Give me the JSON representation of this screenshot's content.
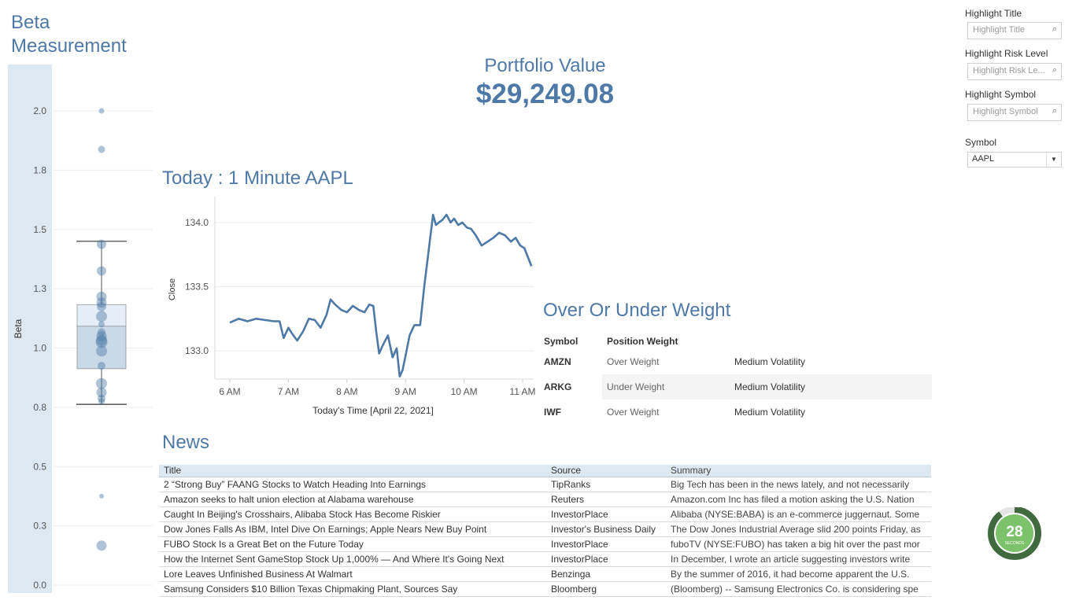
{
  "beta": {
    "title": "Beta Measurement",
    "axis_label": "Beta",
    "ticks": [
      "2.0",
      "1.8",
      "1.5",
      "1.3",
      "1.0",
      "0.8",
      "0.5",
      "0.3",
      "0.0"
    ]
  },
  "portfolio": {
    "label": "Portfolio Value",
    "value": "$29,249.08"
  },
  "today": {
    "title": "Today : 1 Minute AAPL"
  },
  "ouw": {
    "title": "Over Or Under Weight",
    "headers": {
      "symbol": "Symbol",
      "position": "Position Weight"
    },
    "rows": [
      {
        "symbol": "AMZN",
        "position": "Over Weight",
        "volatility": "Medium Volatility"
      },
      {
        "symbol": "ARKG",
        "position": "Under Weight",
        "volatility": "Medium Volatility"
      },
      {
        "symbol": "IWF",
        "position": "Over Weight",
        "volatility": "Medium Volatility"
      }
    ]
  },
  "news": {
    "title": "News",
    "headers": {
      "title": "Title",
      "source": "Source",
      "summary": "Summary"
    },
    "rows": [
      {
        "title": "2 “Strong Buy” FAANG Stocks to Watch Heading Into Earnings",
        "source": "TipRanks",
        "summary": "Big Tech has been in the news lately, and not necessarily"
      },
      {
        "title": "Amazon seeks to halt union election at Alabama warehouse",
        "source": "Reuters",
        "summary": "Amazon.com Inc has filed a motion asking the U.S. Nation"
      },
      {
        "title": "Caught In Beijing's Crosshairs, Alibaba Stock Has Become Riskier",
        "source": "InvestorPlace",
        "summary": "Alibaba (NYSE:BABA) is an e-commerce juggernaut. Some"
      },
      {
        "title": "Dow Jones Falls As IBM, Intel Dive On Earnings; Apple Nears New Buy Point",
        "source": "Investor's Business Daily",
        "summary": "The Dow Jones Industrial Average slid 200 points Friday, as"
      },
      {
        "title": "FUBO Stock Is a Great Bet on the Future Today",
        "source": "InvestorPlace",
        "summary": "fuboTV (NYSE:FUBO) has taken a big hit over the past mor"
      },
      {
        "title": "How the Internet Sent GameStop Stock Up 1,000% — And Where It's Going Next",
        "source": "InvestorPlace",
        "summary": "In December, I wrote an article suggesting investors write"
      },
      {
        "title": "Lore Leaves Unfinished Business At Walmart",
        "source": "Benzinga",
        "summary": "By the summer of 2016, it had become apparent the U.S."
      },
      {
        "title": "Samsung Considers $10 Billion Texas Chipmaking Plant, Sources Say",
        "source": "Bloomberg",
        "summary": "(Bloomberg) -- Samsung Electronics Co. is considering spe"
      }
    ]
  },
  "filters": {
    "highlight_title": {
      "label": "Highlight Title",
      "placeholder": "Highlight Title"
    },
    "highlight_risk": {
      "label": "Highlight Risk Level",
      "placeholder": "Highlight Risk Le..."
    },
    "highlight_symbol": {
      "label": "Highlight Symbol",
      "placeholder": "Highlight Symbol"
    },
    "symbol": {
      "label": "Symbol",
      "selected": "AAPL"
    }
  },
  "timer": {
    "value": "28",
    "unit": "SECONDS",
    "progress": 0.9
  },
  "chart_data": [
    {
      "type": "line",
      "xlabel": "Today's Time [April 22, 2021]",
      "ylabel": "Close",
      "x_ticks": [
        "6 AM",
        "7 AM",
        "8 AM",
        "9 AM",
        "10 AM",
        "11 AM"
      ],
      "y_ticks": [
        "133.0",
        "133.5",
        "134.0"
      ],
      "ylim": [
        132.78,
        134.14
      ],
      "x_hours": [
        6.0,
        6.15,
        6.3,
        6.45,
        6.6,
        6.75,
        6.85,
        6.92,
        7.0,
        7.07,
        7.15,
        7.25,
        7.35,
        7.45,
        7.55,
        7.65,
        7.72,
        7.8,
        7.9,
        8.0,
        8.1,
        8.2,
        8.3,
        8.38,
        8.45,
        8.5,
        8.55,
        8.62,
        8.7,
        8.78,
        8.85,
        8.9,
        8.95,
        9.0,
        9.07,
        9.15,
        9.25,
        9.32,
        9.4,
        9.47,
        9.52,
        9.57,
        9.63,
        9.7,
        9.77,
        9.83,
        9.9,
        9.97,
        10.05,
        10.12,
        10.2,
        10.3,
        10.4,
        10.5,
        10.6,
        10.7,
        10.8,
        10.88,
        10.96,
        11.03,
        11.1,
        11.15
      ],
      "y": [
        133.22,
        133.25,
        133.23,
        133.25,
        133.24,
        133.23,
        133.23,
        133.1,
        133.18,
        133.13,
        133.08,
        133.15,
        133.25,
        133.24,
        133.18,
        133.28,
        133.4,
        133.36,
        133.32,
        133.3,
        133.35,
        133.32,
        133.3,
        133.36,
        133.35,
        133.15,
        132.98,
        133.05,
        133.12,
        132.95,
        133.02,
        132.8,
        132.85,
        132.96,
        133.12,
        133.2,
        133.2,
        133.5,
        133.8,
        134.06,
        133.98,
        134.0,
        134.02,
        134.06,
        134.0,
        134.03,
        133.98,
        134.0,
        133.96,
        133.95,
        133.9,
        133.82,
        133.85,
        133.88,
        133.92,
        133.9,
        133.85,
        133.88,
        133.82,
        133.8,
        133.72,
        133.66
      ]
    },
    {
      "type": "scatter",
      "title": "Beta Measurement",
      "ylabel": "Beta",
      "ylim": [
        0.0,
        2.0
      ],
      "y": [
        2.0,
        1.87,
        1.45,
        1.36,
        1.26,
        1.23,
        1.21,
        1.16,
        1.12,
        1.08,
        1.06,
        1.04,
        1.03,
        0.99,
        0.94,
        0.88,
        0.85,
        0.83,
        0.82,
        0.4,
        0.2
      ],
      "box": {
        "whisker_low": 0.81,
        "q1": 0.93,
        "median": 1.11,
        "q3": 1.22,
        "whisker_high": 1.46
      }
    }
  ]
}
